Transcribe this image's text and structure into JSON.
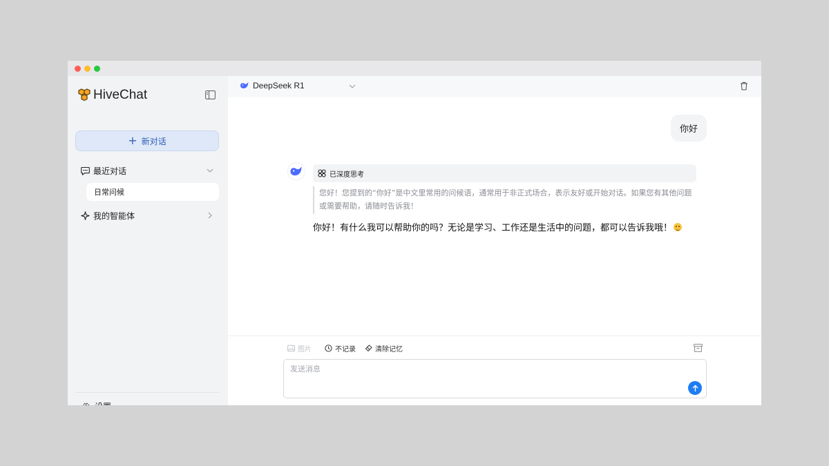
{
  "app": {
    "name": "HiveChat",
    "brand_color": "#f5a623",
    "accent_color": "#1f7cf3"
  },
  "sidebar": {
    "new_chat_label": "新对话",
    "recent_label": "最近对话",
    "recent_items": [
      {
        "label": "日常问候"
      }
    ],
    "agents_label": "我的智能体",
    "settings_label": "设置"
  },
  "header": {
    "model_name": "DeepSeek R1"
  },
  "conversation": {
    "user_message": "你好",
    "thinking_label": "已深度思考",
    "thinking_text": "您好！您提到的“你好”是中文里常用的问候语，通常用于非正式场合，表示友好或开始对话。如果您有其他问题或需要帮助，请随时告诉我！",
    "answer_text": "你好！有什么我可以帮助你的吗？无论是学习、工作还是生活中的问题，都可以告诉我哦！",
    "answer_emoji": "smiling-face-emoji"
  },
  "composer": {
    "image_label": "图片",
    "no_record_label": "不记录",
    "clear_memory_label": "清除记忆",
    "placeholder": "发送消息"
  },
  "icons": {
    "logo": "hive-logo-icon",
    "sidebar_toggle": "sidebar-toggle-icon",
    "recent": "chat-bubble-icon",
    "agents": "sparkle-icon",
    "settings": "gear-icon",
    "model": "whale-icon",
    "trash": "trash-icon",
    "thinking": "atom-icon",
    "send": "arrow-up-icon"
  }
}
